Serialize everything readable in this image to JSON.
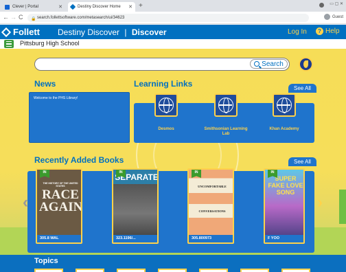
{
  "browser": {
    "tabs": [
      {
        "title": "Clever | Portal",
        "active": false
      },
      {
        "title": "Destiny Discover Home",
        "active": true
      }
    ],
    "new_tab": "+",
    "url": "search.follettsoftware.com/metasearch/ui/34623",
    "back": "←",
    "forward": "→",
    "reload": "C",
    "profile_label": "Guest"
  },
  "header": {
    "brand": "Follett",
    "product": "Destiny Discover",
    "separator": "|",
    "section": "Discover",
    "login": "Log In",
    "help": "Help"
  },
  "site": {
    "name": "Pittsburg High School"
  },
  "search": {
    "placeholder": "",
    "button": "Search"
  },
  "news": {
    "heading": "News",
    "items": [
      "Welcome to the PHS Library!"
    ]
  },
  "learning_links": {
    "heading": "Learning Links",
    "see_all": "See All",
    "links": [
      {
        "label": "Desmos"
      },
      {
        "label": "Smithsonian Learning Lab"
      },
      {
        "label": "Khan Academy"
      }
    ]
  },
  "recent_books": {
    "heading": "Recently Added Books",
    "see_all": "See All",
    "books": [
      {
        "flag": "IN",
        "call_number": "305.8 WAL",
        "cover_title": "RACE AGAINST",
        "cover_sub": "THE HISTORY OF THE UNITED STATES"
      },
      {
        "flag": "IN",
        "call_number": "323.1196/...",
        "cover_title": "SEPARATE"
      },
      {
        "flag": "IN",
        "call_number": "305.800973",
        "cover_title": "UNCOMFORTABLE",
        "cover_sub": "CONVERSATIONS"
      },
      {
        "flag": "IN",
        "call_number": "F YOO",
        "cover_title": "SUPER FAKE LOVE SONG"
      }
    ]
  },
  "topics": {
    "heading": "Topics"
  },
  "colors": {
    "brand_blue": "#0070c0",
    "accent_yellow": "#ffd24a",
    "panel_blue": "#1f74cc",
    "menu_green": "#3d9b3d"
  }
}
